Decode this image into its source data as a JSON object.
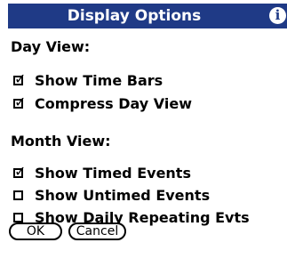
{
  "dialog": {
    "title": "Display Options",
    "info_icon": "info-icon",
    "colors": {
      "title_bar": "#1f3a86",
      "title_text": "#ffffff",
      "background": "#ffffff"
    }
  },
  "day_view": {
    "heading": "Day View:",
    "options": [
      {
        "label": "Show Time Bars",
        "checked": true
      },
      {
        "label": "Compress Day View",
        "checked": true
      }
    ]
  },
  "month_view": {
    "heading": "Month View:",
    "options": [
      {
        "label": "Show Timed Events",
        "checked": true
      },
      {
        "label": "Show Untimed Events",
        "checked": false
      },
      {
        "label": "Show Daily Repeating Evts",
        "checked": false
      }
    ]
  },
  "buttons": {
    "ok": "OK",
    "cancel": "Cancel"
  }
}
